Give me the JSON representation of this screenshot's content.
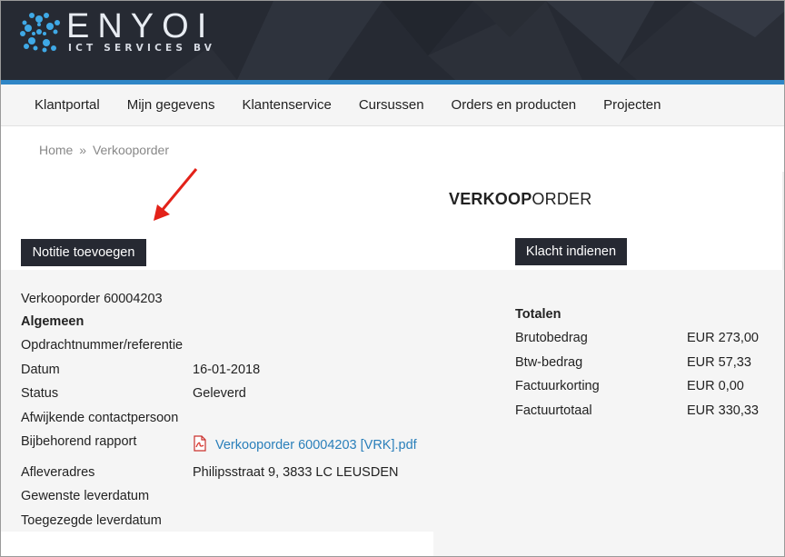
{
  "brand": {
    "logo_word": "ENYOI",
    "logo_sub": "ICT SERVICES BV"
  },
  "nav": {
    "items": [
      {
        "label": "Klantportal"
      },
      {
        "label": "Mijn gegevens"
      },
      {
        "label": "Klantenservice"
      },
      {
        "label": "Cursussen"
      },
      {
        "label": "Orders en producten"
      },
      {
        "label": "Projecten"
      }
    ]
  },
  "breadcrumb": {
    "home": "Home",
    "separator": "»",
    "current": "Verkooporder"
  },
  "page": {
    "title_bold": "VERKOOP",
    "title_rest": "ORDER"
  },
  "actions": {
    "add_note": "Notitie toevoegen",
    "complaint": "Klacht indienen"
  },
  "order": {
    "heading": "Verkooporder 60004203",
    "section": "Algemeen",
    "fields": [
      {
        "label": "Opdrachtnummer/referentie",
        "value": ""
      },
      {
        "label": "Datum",
        "value": "16-01-2018"
      },
      {
        "label": "Status",
        "value": "Geleverd"
      },
      {
        "label": "Afwijkende contactpersoon",
        "value": ""
      },
      {
        "label": "Bijbehorend rapport",
        "value": "Verkooporder 60004203 [VRK].pdf"
      },
      {
        "label": "Afleveradres",
        "value": "Philipsstraat 9, 3833 LC LEUSDEN"
      },
      {
        "label": "Gewenste leverdatum",
        "value": ""
      },
      {
        "label": "Toegezegde leverdatum",
        "value": ""
      }
    ]
  },
  "totals": {
    "heading": "Totalen",
    "rows": [
      {
        "label": "Brutobedrag",
        "value": "EUR 273,00"
      },
      {
        "label": "Btw-bedrag",
        "value": "EUR 57,33"
      },
      {
        "label": "Factuurkorting",
        "value": "EUR 0,00"
      },
      {
        "label": "Factuurtotaal",
        "value": "EUR 330,33"
      }
    ]
  },
  "colors": {
    "header_bg": "#262a33",
    "accent_blue": "#2f86c6",
    "button_bg": "#262932",
    "link": "#2a7fba",
    "annotation_arrow": "#e32219"
  },
  "icons": {
    "logo": "snowflake-logo-icon",
    "report": "pdf-file-icon",
    "annotation": "red-arrow-icon"
  }
}
